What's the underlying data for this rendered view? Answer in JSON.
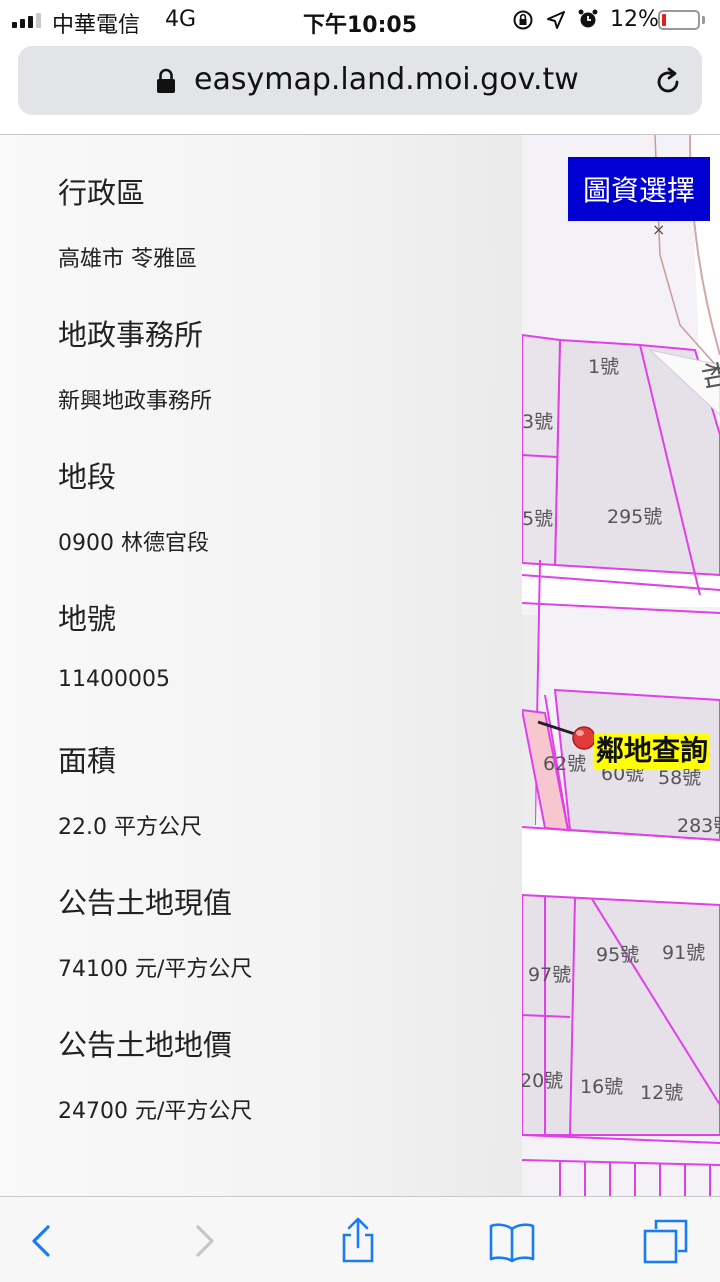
{
  "status": {
    "carrier": "中華電信",
    "network": "4G",
    "time": "下午10:05",
    "battery_percent": "12%",
    "battery_level": 0.12,
    "battery_color": "#e0201d",
    "icons": [
      "signal-icon",
      "rotation-lock-icon",
      "location-icon",
      "alarm-icon",
      "battery-icon"
    ]
  },
  "browser": {
    "url": "easymap.land.moi.gov.tw",
    "icons": [
      "lock-icon",
      "reload-icon"
    ]
  },
  "drawer": {
    "fields": [
      {
        "label": "行政區",
        "value": "高雄市 苓雅區"
      },
      {
        "label": "地政事務所",
        "value": "新興地政事務所"
      },
      {
        "label": "地段",
        "value": "0900 林德官段"
      },
      {
        "label": "地號",
        "value": "11400005"
      },
      {
        "label": "面積",
        "value": "22.0 平方公尺"
      },
      {
        "label": "公告土地現值",
        "value": "74100 元/平方公尺"
      },
      {
        "label": "公告土地地價",
        "value": "24700 元/平方公尺"
      }
    ]
  },
  "map": {
    "layer_button": "圖資選擇",
    "neighbor_button": "鄰地查詢",
    "road_label": "和",
    "parcel_labels": [
      "1號",
      "3號",
      "5號",
      "295號",
      "62號",
      "60號",
      "58號",
      "283號",
      "95號",
      "91號",
      "97號",
      "20號",
      "16號",
      "12號"
    ],
    "parcel_line_color": "#e040e8",
    "button_color": "#0000d2",
    "highlight_color": "#ffff00"
  },
  "toolbar": {
    "icons": [
      "back-icon",
      "forward-icon",
      "share-icon",
      "bookmarks-icon",
      "tabs-icon"
    ],
    "accent_color": "#1a7cf5"
  }
}
